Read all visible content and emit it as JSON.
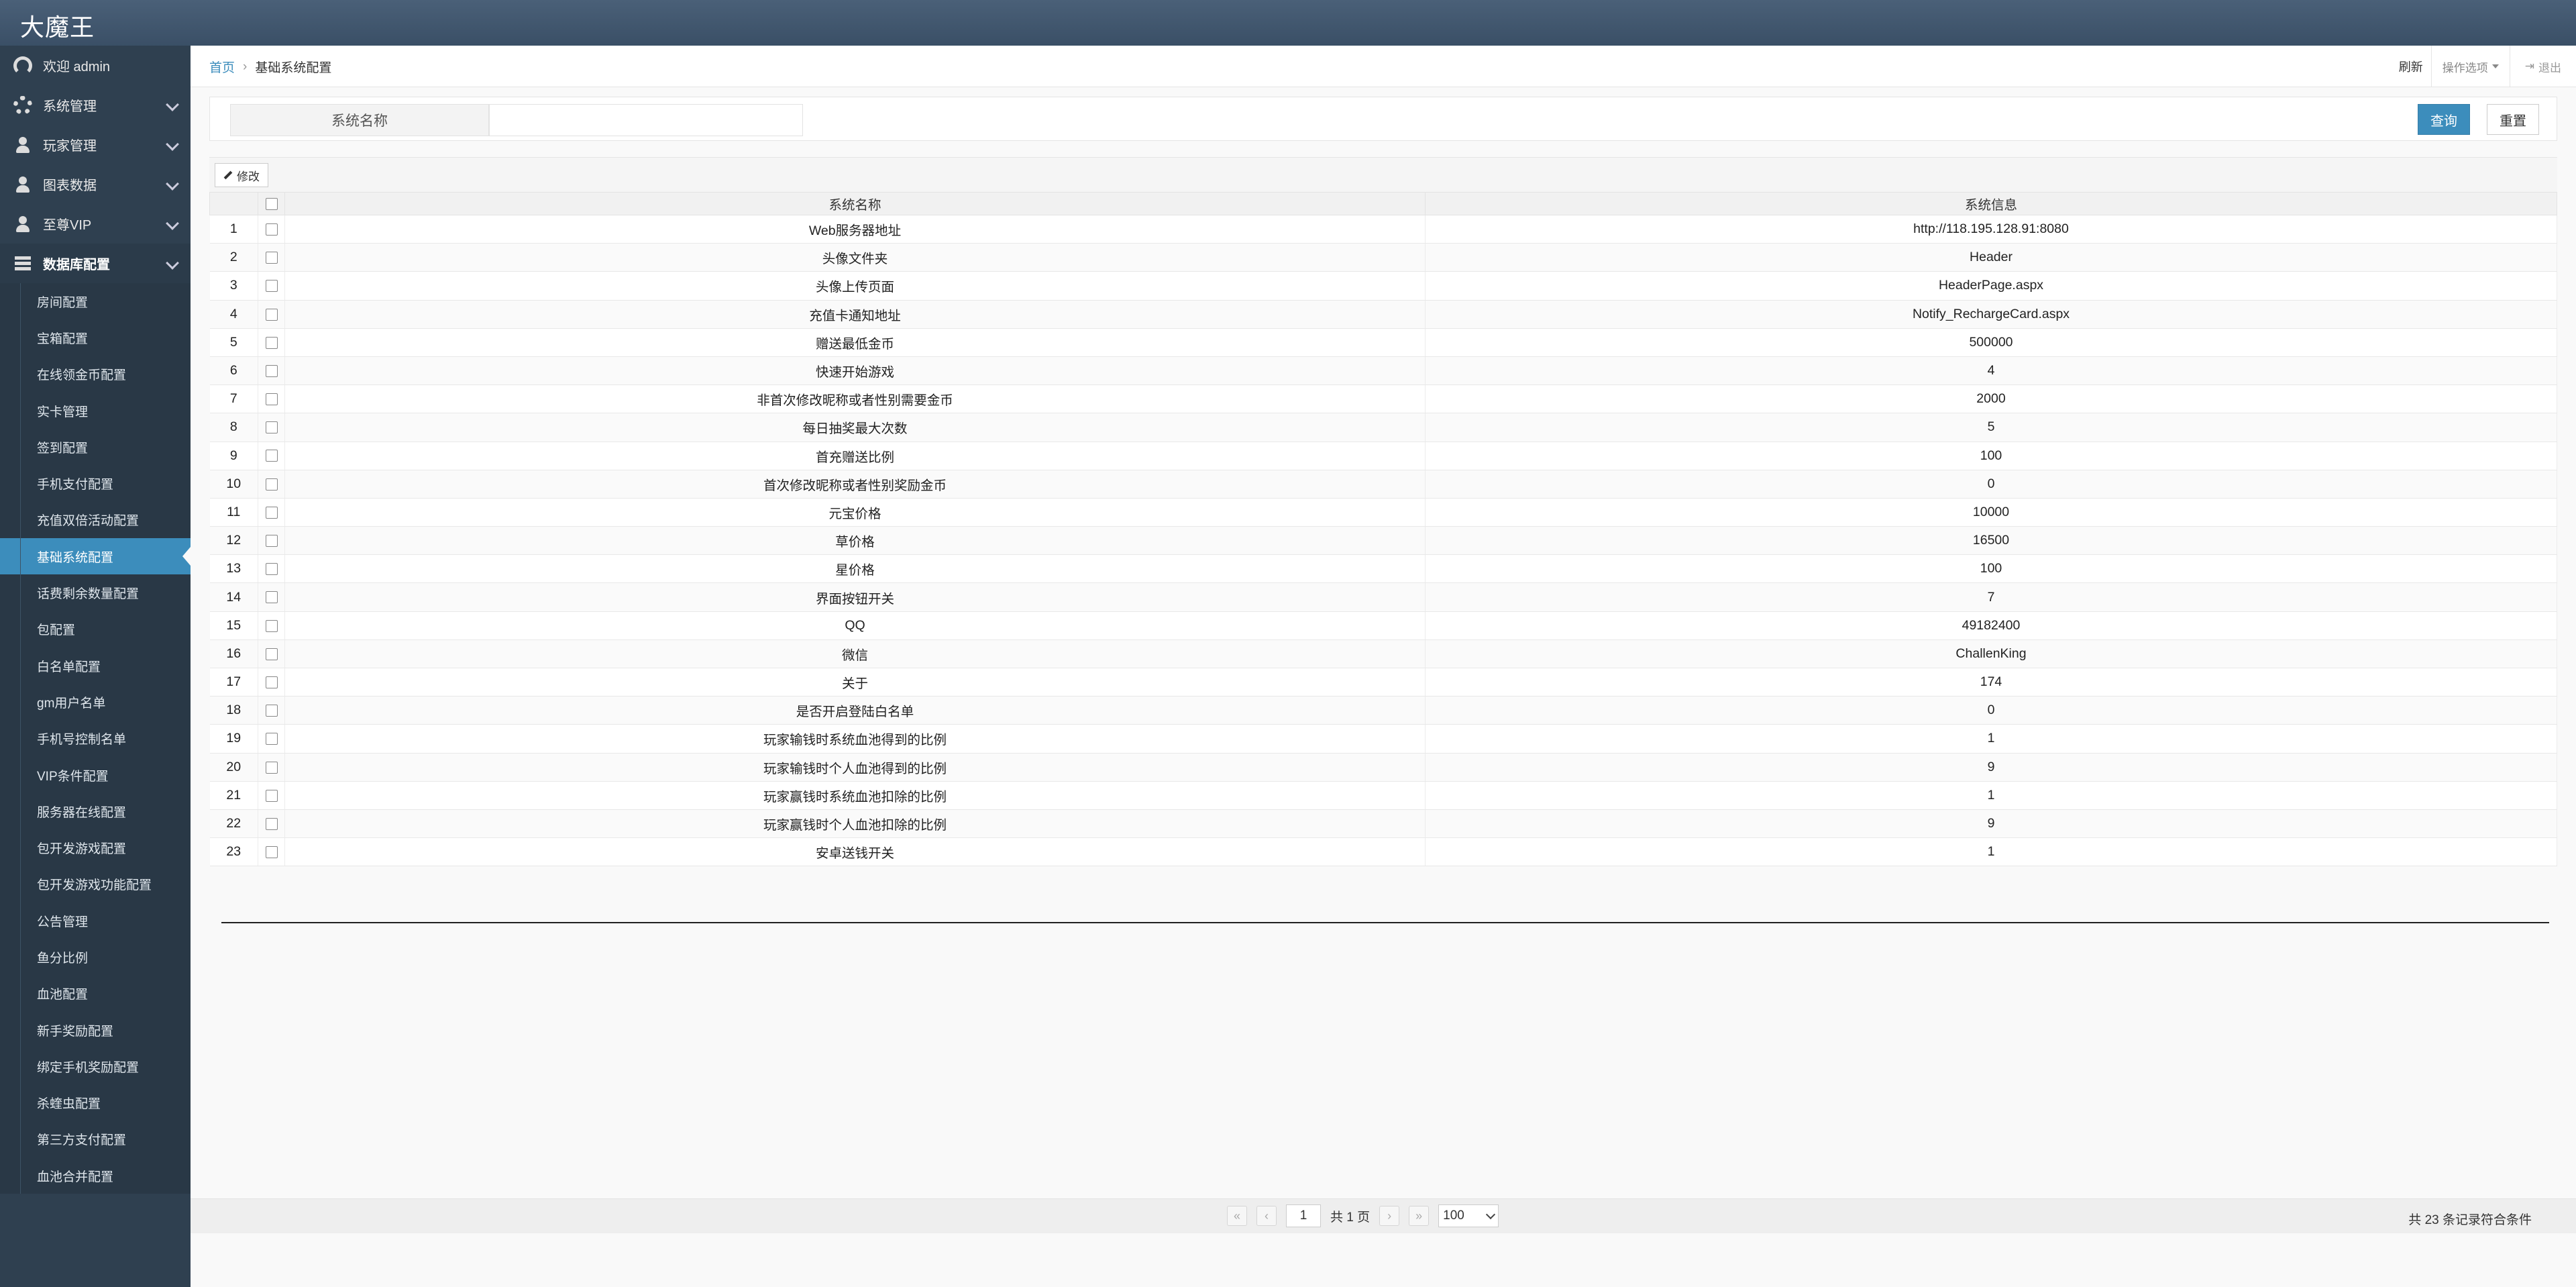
{
  "app": {
    "title": "大魔王"
  },
  "sidebar": {
    "top_items": [
      {
        "label": "欢迎 admin",
        "icon": "dashboard-icon"
      },
      {
        "label": "系统管理",
        "icon": "gear-icon"
      },
      {
        "label": "玩家管理",
        "icon": "user-icon"
      },
      {
        "label": "图表数据",
        "icon": "user-icon"
      },
      {
        "label": "至尊VIP",
        "icon": "user-icon"
      },
      {
        "label": "数据库配置",
        "icon": "database-icon"
      }
    ],
    "sub_items": [
      "房间配置",
      "宝箱配置",
      "在线领金币配置",
      "实卡管理",
      "签到配置",
      "手机支付配置",
      "充值双倍活动配置",
      "基础系统配置",
      "话费剩余数量配置",
      "包配置",
      "白名单配置",
      "gm用户名单",
      "手机号控制名单",
      "VIP条件配置",
      "服务器在线配置",
      "包开发游戏配置",
      "包开发游戏功能配置",
      "公告管理",
      "鱼分比例",
      "血池配置",
      "新手奖励配置",
      "绑定手机奖励配置",
      "杀蝰虫配置",
      "第三方支付配置",
      "血池合并配置"
    ],
    "active_sub": "基础系统配置"
  },
  "breadcrumb": {
    "home": "首页",
    "separator": "›",
    "current": "基础系统配置"
  },
  "topright": {
    "refresh": "刷新",
    "options": "操作选项",
    "logout": "退出"
  },
  "search": {
    "label": "系统名称",
    "value": "",
    "query_button": "查询",
    "reset_button": "重置"
  },
  "toolbar": {
    "edit_button": "修改"
  },
  "table": {
    "columns": [
      "系统名称",
      "系统信息"
    ],
    "rows": [
      {
        "no": "1",
        "name": "Web服务器地址",
        "info": "http://118.195.128.91:8080"
      },
      {
        "no": "2",
        "name": "头像文件夹",
        "info": "Header"
      },
      {
        "no": "3",
        "name": "头像上传页面",
        "info": "HeaderPage.aspx"
      },
      {
        "no": "4",
        "name": "充值卡通知地址",
        "info": "Notify_RechargeCard.aspx"
      },
      {
        "no": "5",
        "name": "赠送最低金币",
        "info": "500000"
      },
      {
        "no": "6",
        "name": "快速开始游戏",
        "info": "4"
      },
      {
        "no": "7",
        "name": "非首次修改昵称或者性别需要金币",
        "info": "2000"
      },
      {
        "no": "8",
        "name": "每日抽奖最大次数",
        "info": "5"
      },
      {
        "no": "9",
        "name": "首充赠送比例",
        "info": "100"
      },
      {
        "no": "10",
        "name": "首次修改昵称或者性别奖励金币",
        "info": "0"
      },
      {
        "no": "11",
        "name": "元宝价格",
        "info": "10000"
      },
      {
        "no": "12",
        "name": "草价格",
        "info": "16500"
      },
      {
        "no": "13",
        "name": "星价格",
        "info": "100"
      },
      {
        "no": "14",
        "name": "界面按钮开关",
        "info": "7"
      },
      {
        "no": "15",
        "name": "QQ",
        "info": "49182400"
      },
      {
        "no": "16",
        "name": "微信",
        "info": "ChallenKing"
      },
      {
        "no": "17",
        "name": "关于",
        "info": "174"
      },
      {
        "no": "18",
        "name": "是否开启登陆白名单",
        "info": "0"
      },
      {
        "no": "19",
        "name": "玩家输钱时系统血池得到的比例",
        "info": "1"
      },
      {
        "no": "20",
        "name": "玩家输钱时个人血池得到的比例",
        "info": "9"
      },
      {
        "no": "21",
        "name": "玩家赢钱时系统血池扣除的比例",
        "info": "1"
      },
      {
        "no": "22",
        "name": "玩家赢钱时个人血池扣除的比例",
        "info": "9"
      },
      {
        "no": "23",
        "name": "安卓送钱开关",
        "info": "1"
      }
    ]
  },
  "pagination": {
    "page": "1",
    "total_pages_text": "共 1 页",
    "page_size": "100",
    "summary": "共 23 条记录符合条件",
    "first_icon": "«",
    "prev_icon": "‹",
    "next_icon": "›",
    "last_icon": "»"
  },
  "colors": {
    "accent": "#3c8dbc",
    "sidebar": "#2f4050",
    "topbar": "#435a72"
  }
}
